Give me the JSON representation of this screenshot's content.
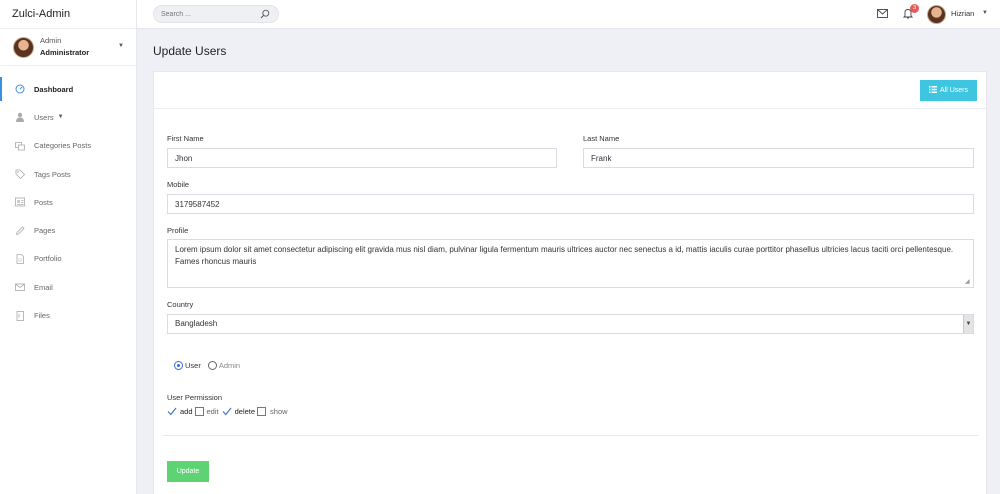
{
  "app": {
    "brand": "Zulci-Admin"
  },
  "sidebar": {
    "user": {
      "name": "Admin",
      "role": "Administrator"
    },
    "items": [
      {
        "label": "Dashboard",
        "icon": "dashboard-icon"
      },
      {
        "label": "Users",
        "icon": "user-icon"
      },
      {
        "label": "Categories Posts",
        "icon": "categories-icon"
      },
      {
        "label": "Tags Posts",
        "icon": "tag-icon"
      },
      {
        "label": "Posts",
        "icon": "posts-icon"
      },
      {
        "label": "Pages",
        "icon": "pencil-icon"
      },
      {
        "label": "Portfolio",
        "icon": "document-icon"
      },
      {
        "label": "Email",
        "icon": "envelope-icon"
      },
      {
        "label": "Files",
        "icon": "file-icon"
      }
    ]
  },
  "topbar": {
    "search_placeholder": "Search ...",
    "notification_count": "3",
    "username": "Hizrian"
  },
  "page": {
    "title": "Update Users"
  },
  "card": {
    "all_users_label": "All Users"
  },
  "form": {
    "first_name": {
      "label": "First Name",
      "value": "Jhon"
    },
    "last_name": {
      "label": "Last Name",
      "value": "Frank"
    },
    "mobile": {
      "label": "Mobile",
      "value": "3179587452"
    },
    "profile": {
      "label": "Profile",
      "value": "Lorem ipsum dolor sit amet consectetur adipiscing elit gravida mus nisl diam, pulvinar ligula fermentum mauris ultrices auctor nec senectus a id, mattis iaculis curae porttitor phasellus ultricies lacus taciti orci pellentesque. Fames rhoncus mauris"
    },
    "country": {
      "label": "Country",
      "value": "Bangladesh"
    },
    "role": {
      "options": [
        {
          "label": "User",
          "checked": true
        },
        {
          "label": "Admin",
          "checked": false
        }
      ]
    },
    "permission": {
      "label": "User Permission",
      "options": [
        {
          "label": "add",
          "checked": true
        },
        {
          "label": "edit",
          "checked": false
        },
        {
          "label": "delete",
          "checked": true
        },
        {
          "label": "show",
          "checked": false
        }
      ]
    },
    "submit_label": "Update"
  },
  "colors": {
    "accent_blue": "#3b8ee6",
    "info_button": "#3ec6e0",
    "success_button": "#5dd373",
    "badge_red": "#e85a5a"
  }
}
